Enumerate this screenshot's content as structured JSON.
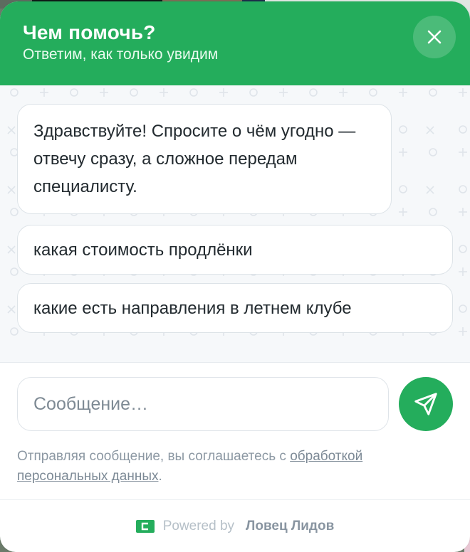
{
  "header": {
    "title": "Чем помочь?",
    "subtitle": "Ответим, как только увидим"
  },
  "chat": {
    "bot_message": "Здравствуйте! Спросите о чём угодно — отвечу сразу, а сложное передам специалисту.",
    "quick_replies": [
      {
        "label": "какая стоимость продлёнки"
      },
      {
        "label": "какие есть направления в летнем клубе"
      }
    ]
  },
  "composer": {
    "placeholder": "Сообщение…",
    "consent_prefix": "Отправляя сообщение, вы соглашаетесь с ",
    "consent_link": "обработкой персональных данных",
    "consent_suffix": "."
  },
  "footer": {
    "powered_by": "Powered by",
    "brand": "Ловец Лидов"
  },
  "colors": {
    "accent": "#24ad5c",
    "bubble_border": "#dde3e8",
    "muted_text": "#8c98a3"
  },
  "icons": {
    "close": "close-icon",
    "send": "send-icon",
    "brand_logo": "leadhunter-logo-icon"
  }
}
